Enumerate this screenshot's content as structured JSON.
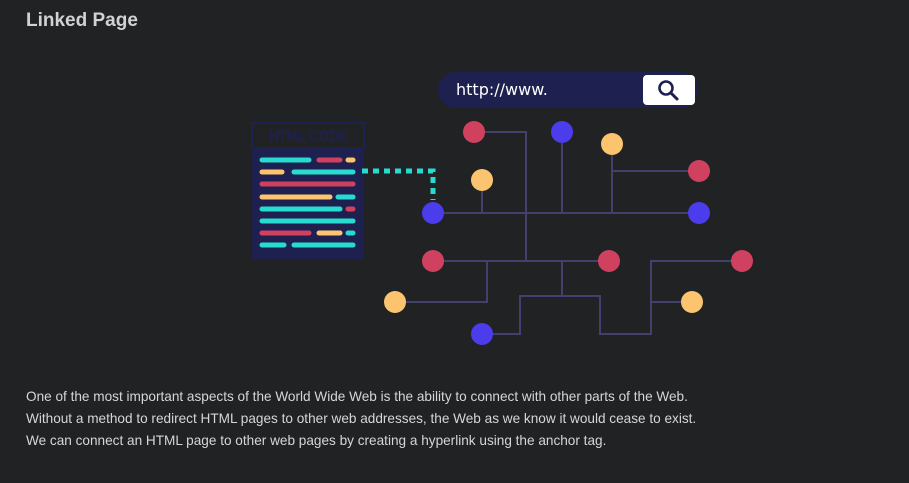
{
  "page": {
    "title": "Linked Page"
  },
  "illustration": {
    "address_bar": {
      "url": "http://www.",
      "icon": "search-icon"
    },
    "document_header": "HTML CODE",
    "colors": {
      "red": "#d0415f",
      "blue": "#4b3cec",
      "yellow": "#fcc46e",
      "teal": "#28dbd1",
      "navy": "#1e2150",
      "line": "#41406e"
    }
  },
  "description": {
    "lines": [
      "One of the most important aspects of the World Wide Web is the ability to connect with other parts of the Web.",
      "Without a method to redirect HTML pages to other web addresses, the Web as we know it would cease to exist.",
      "We can connect an HTML page to other web pages by creating a hyperlink using the anchor tag."
    ]
  }
}
